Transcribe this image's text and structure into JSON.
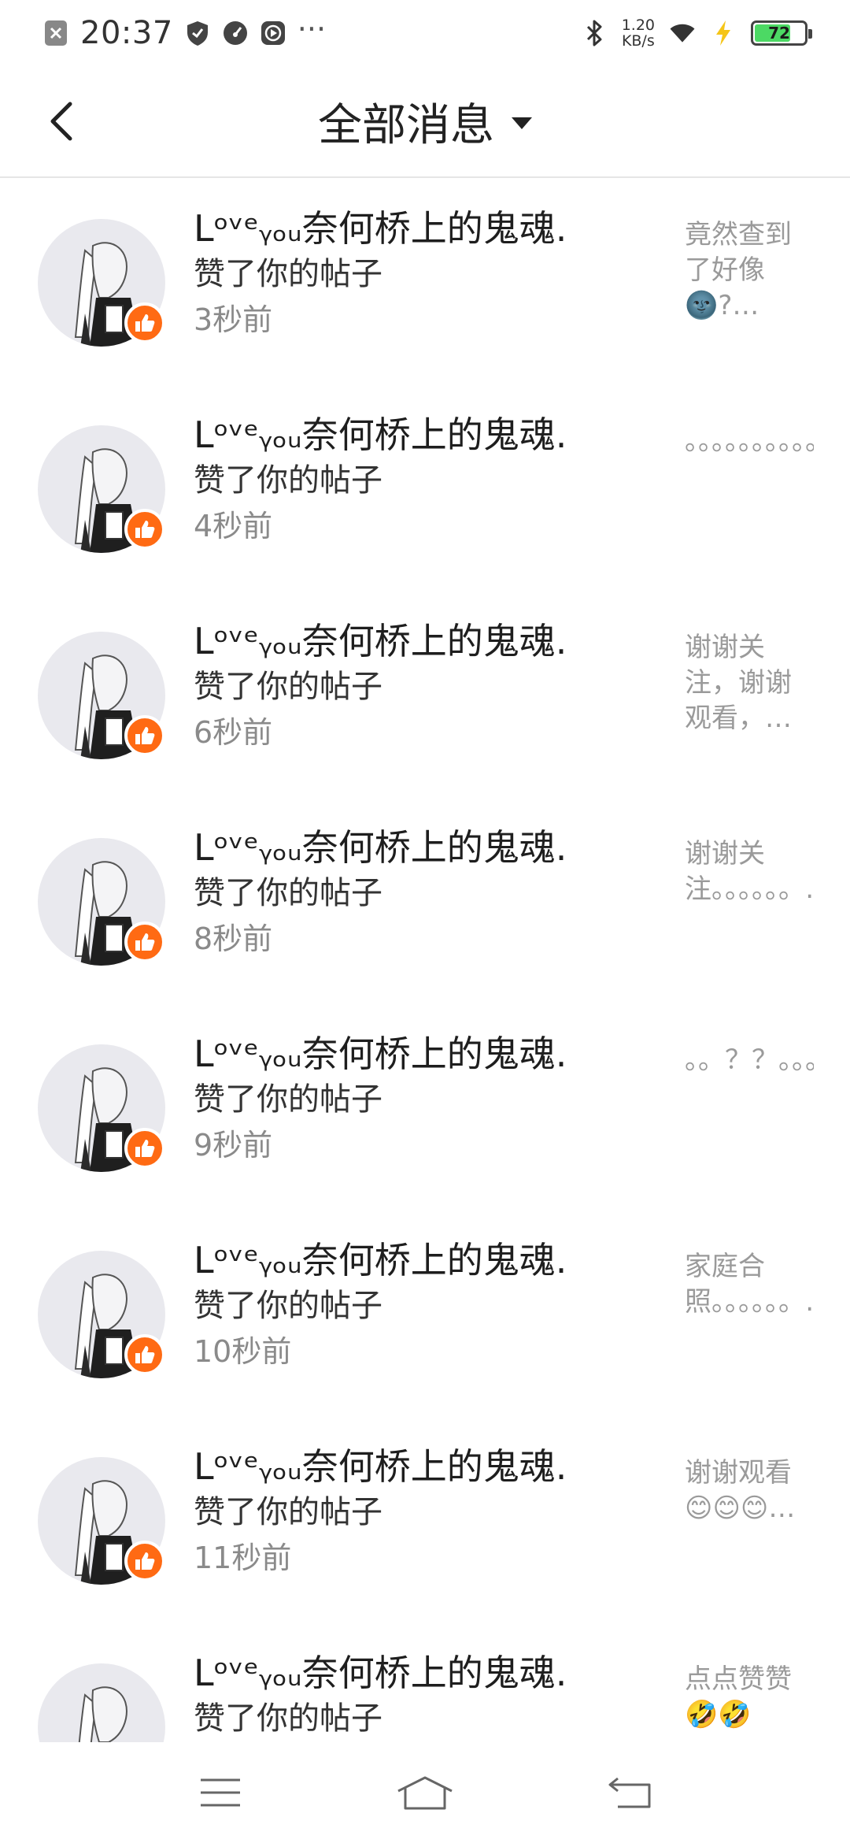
{
  "status_bar": {
    "time": "20:37",
    "net_speed_value": "1.20",
    "net_speed_unit": "KB/s",
    "battery": "72",
    "battery_level": 0.72,
    "icons_left": [
      "close-box-icon",
      "shield-icon",
      "speedometer-icon",
      "play-icon",
      "more-dots-icon"
    ],
    "icons_right": [
      "bluetooth-icon",
      "wifi-icon",
      "charging-bolt-icon",
      "battery-icon"
    ],
    "more": "···"
  },
  "header": {
    "title": "全部消息",
    "back_icon": "chevron-left-icon",
    "dropdown_icon": "caret-down-icon"
  },
  "notifications": [
    {
      "username": "Lᵒᵛᵉᵧₒᵤ奈何桥上的鬼魂.",
      "action": "赞了你的帖子",
      "time": "3秒前",
      "preview": "竟然查到了好像🌚?…"
    },
    {
      "username": "Lᵒᵛᵉᵧₒᵤ奈何桥上的鬼魂.",
      "action": "赞了你的帖子",
      "time": "4秒前",
      "preview": "。。。。。。。。。。"
    },
    {
      "username": "Lᵒᵛᵉᵧₒᵤ奈何桥上的鬼魂.",
      "action": "赞了你的帖子",
      "time": "6秒前",
      "preview": "谢谢关注，谢谢观看，…"
    },
    {
      "username": "Lᵒᵛᵉᵧₒᵤ奈何桥上的鬼魂.",
      "action": "赞了你的帖子",
      "time": "8秒前",
      "preview": "谢谢关注。。。。。。…"
    },
    {
      "username": "Lᵒᵛᵉᵧₒᵤ奈何桥上的鬼魂.",
      "action": "赞了你的帖子",
      "time": "9秒前",
      "preview": "。。？？。。。。。。…"
    },
    {
      "username": "Lᵒᵛᵉᵧₒᵤ奈何桥上的鬼魂.",
      "action": "赞了你的帖子",
      "time": "10秒前",
      "preview": "家庭合照。。。。。。…"
    },
    {
      "username": "Lᵒᵛᵉᵧₒᵤ奈何桥上的鬼魂.",
      "action": "赞了你的帖子",
      "time": "11秒前",
      "preview": "谢谢观看😊😊😊…"
    },
    {
      "username": "Lᵒᵛᵉᵧₒᵤ奈何桥上的鬼魂.",
      "action": "赞了你的帖子",
      "time": "",
      "preview": "点点赞赞🤣🤣"
    }
  ],
  "row_icons": {
    "avatar": "avatar",
    "badge": "thumbs-up-icon"
  },
  "nav_bar": {
    "icons": [
      "menu-icon",
      "home-icon",
      "back-icon"
    ]
  },
  "colors": {
    "badge": "#ff6a13",
    "battery": "#4cd964",
    "time_text": "#8a8a8a",
    "preview_text": "#9a9a9a"
  }
}
